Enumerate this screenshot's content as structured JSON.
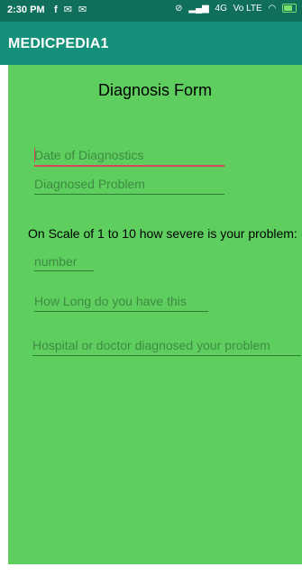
{
  "status": {
    "time": "2:30 PM",
    "left_icons": "f ✉ ✉",
    "right_text": "4G",
    "network_label": "Vo LTE"
  },
  "app": {
    "title": "MEDICPEDIA1"
  },
  "form": {
    "title": "Diagnosis Form",
    "date_placeholder": "Date of Diagnostics",
    "problem_placeholder": "Diagnosed Problem",
    "severity_question": "On Scale of 1 to 10 how severe is your problem:",
    "number_placeholder": "number",
    "duration_placeholder": "How Long do you have this",
    "hospital_placeholder": "Hospital or doctor diagnosed your problem"
  }
}
